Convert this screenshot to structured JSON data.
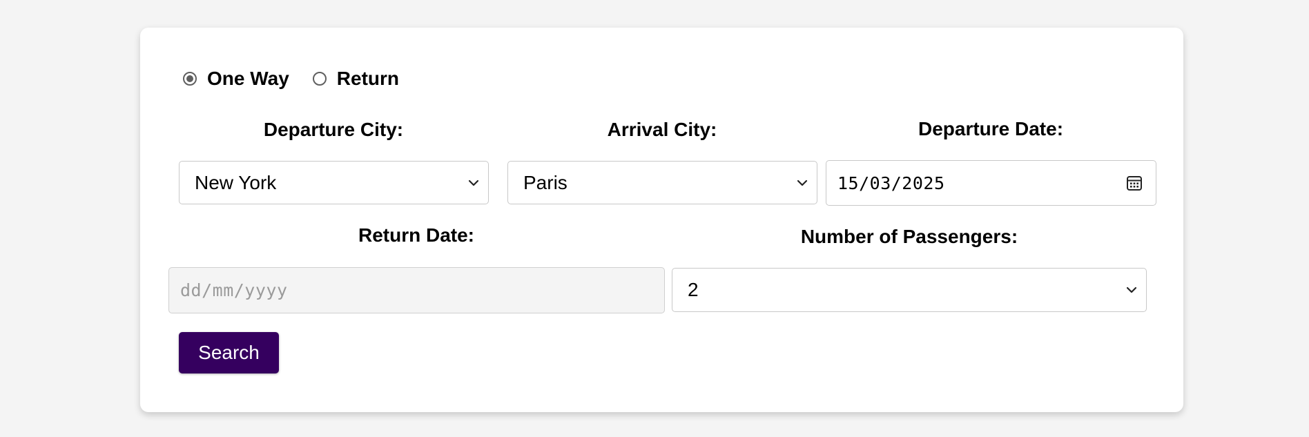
{
  "trip_type": {
    "options": [
      {
        "label": "One Way",
        "checked": true
      },
      {
        "label": "Return",
        "checked": false
      }
    ]
  },
  "departure_city": {
    "label": "Departure City:",
    "value": "New York"
  },
  "arrival_city": {
    "label": "Arrival City:",
    "value": "Paris"
  },
  "departure_date": {
    "label": "Departure Date:",
    "value": "15/03/2025"
  },
  "return_date": {
    "label": "Return Date:",
    "placeholder": "dd/mm/yyyy",
    "disabled": true
  },
  "passengers": {
    "label": "Number of Passengers:",
    "value": "2"
  },
  "search_button": {
    "label": "Search",
    "color": "#35005f"
  },
  "icons": {
    "select_arrow": "chevron-down-icon",
    "date_picker": "calendar-icon"
  }
}
